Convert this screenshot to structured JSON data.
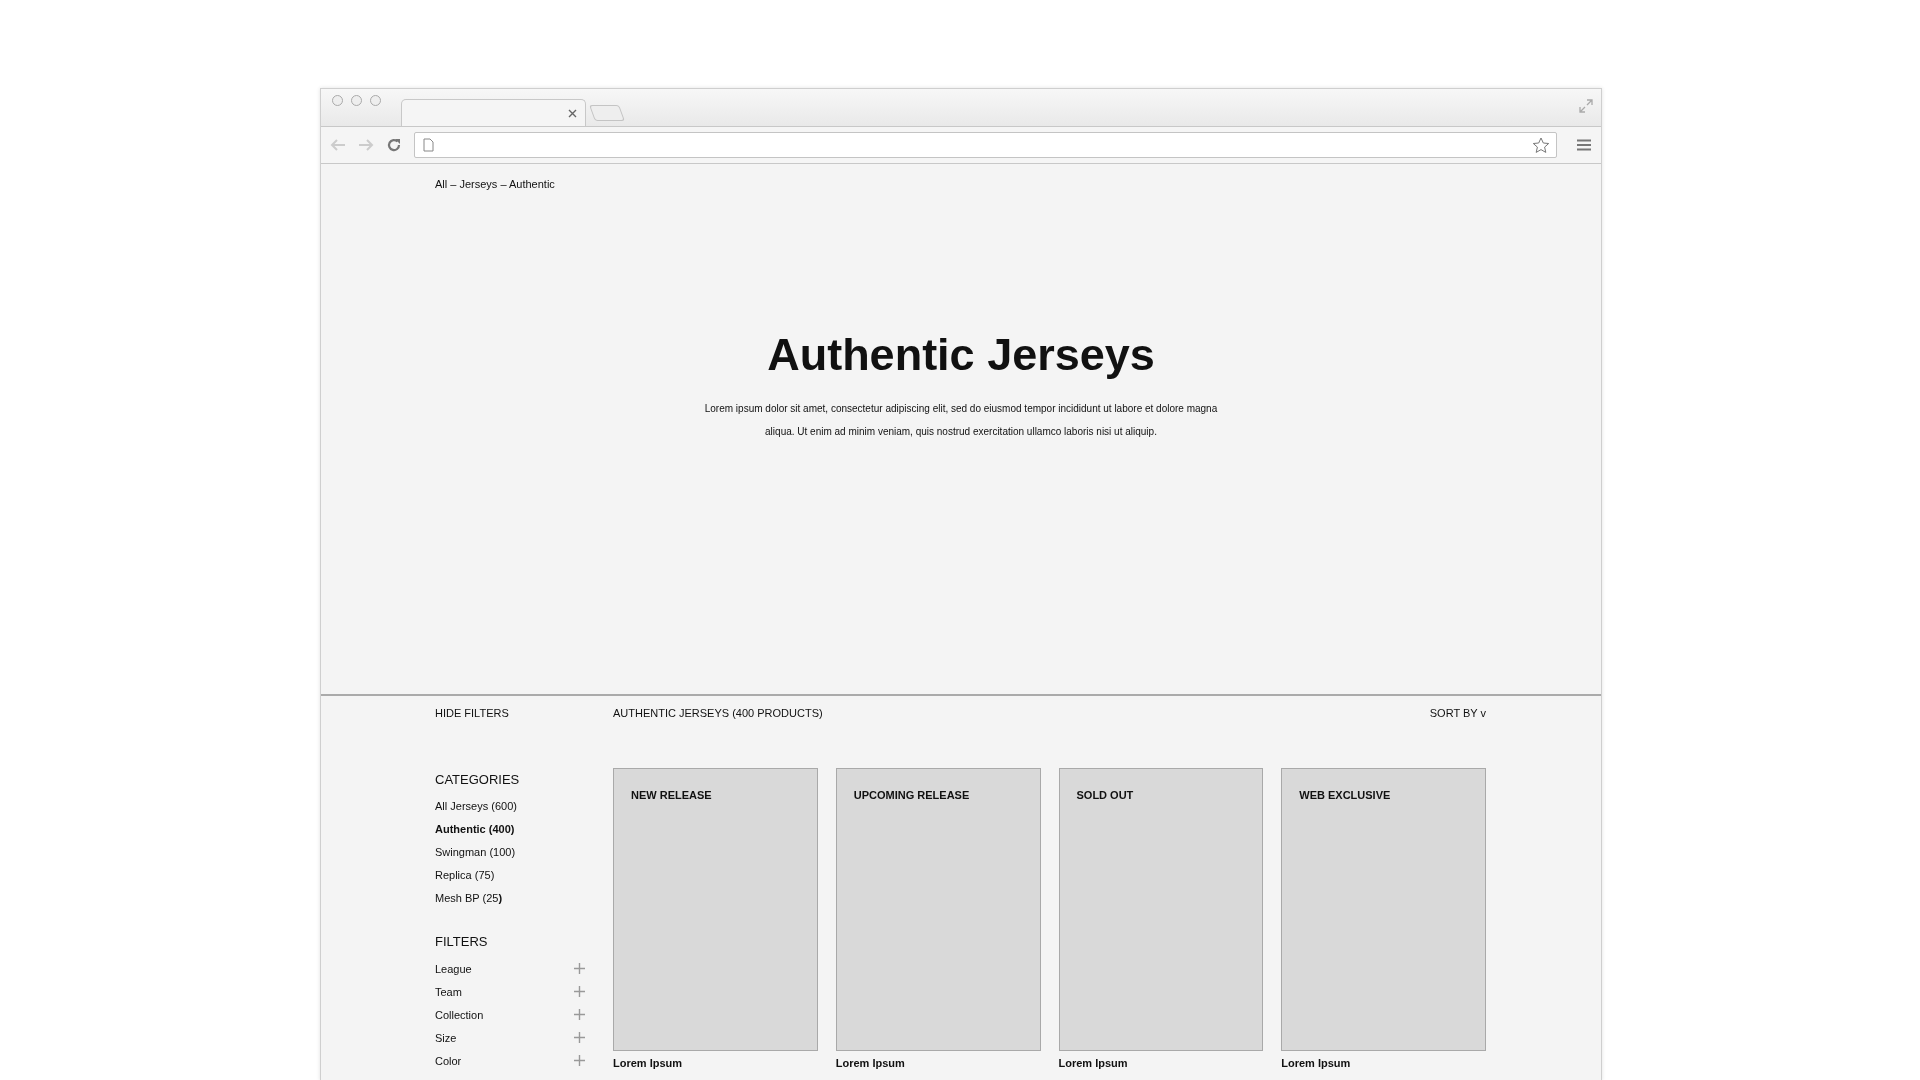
{
  "breadcrumb": "All  – Jerseys – Authentic",
  "hero": {
    "title": "Authentic Jerseys",
    "description": "Lorem ipsum dolor sit amet, consectetur adipiscing elit, sed do eiusmod tempor incididunt ut labore et dolore magna aliqua. Ut enim ad minim veniam, quis nostrud exercitation ullamco laboris nisi ut aliquip."
  },
  "toolbar": {
    "hide_filters": "HIDE FILTERS",
    "results": "AUTHENTIC JERSEYS (400 PRODUCTS)",
    "sort": "SORT BY v"
  },
  "categories": {
    "heading": "CATEGORIES",
    "items": [
      {
        "label": "All Jerseys (600)",
        "selected": false
      },
      {
        "label": "Authentic (400)",
        "selected": true
      },
      {
        "label": "Swingman (100)",
        "selected": false
      },
      {
        "label": "Replica (75)",
        "selected": false
      },
      {
        "label": "Mesh BP (25**)**",
        "selected": false
      }
    ]
  },
  "filters": {
    "heading": "FILTERS",
    "items": [
      {
        "label": "League",
        "expanded": false
      },
      {
        "label": "Team",
        "expanded": false
      },
      {
        "label": "Collection",
        "expanded": false
      },
      {
        "label": "Size",
        "expanded": false
      },
      {
        "label": "Color",
        "expanded": false
      }
    ]
  },
  "products": [
    {
      "tag": "NEW RELEASE",
      "name": "Lorem Ipsum"
    },
    {
      "tag": "UPCOMING RELEASE",
      "name": "Lorem Ipsum"
    },
    {
      "tag": "SOLD OUT",
      "name": "Lorem Ipsum"
    },
    {
      "tag": "WEB EXCLUSIVE",
      "name": "Lorem Ipsum"
    }
  ]
}
